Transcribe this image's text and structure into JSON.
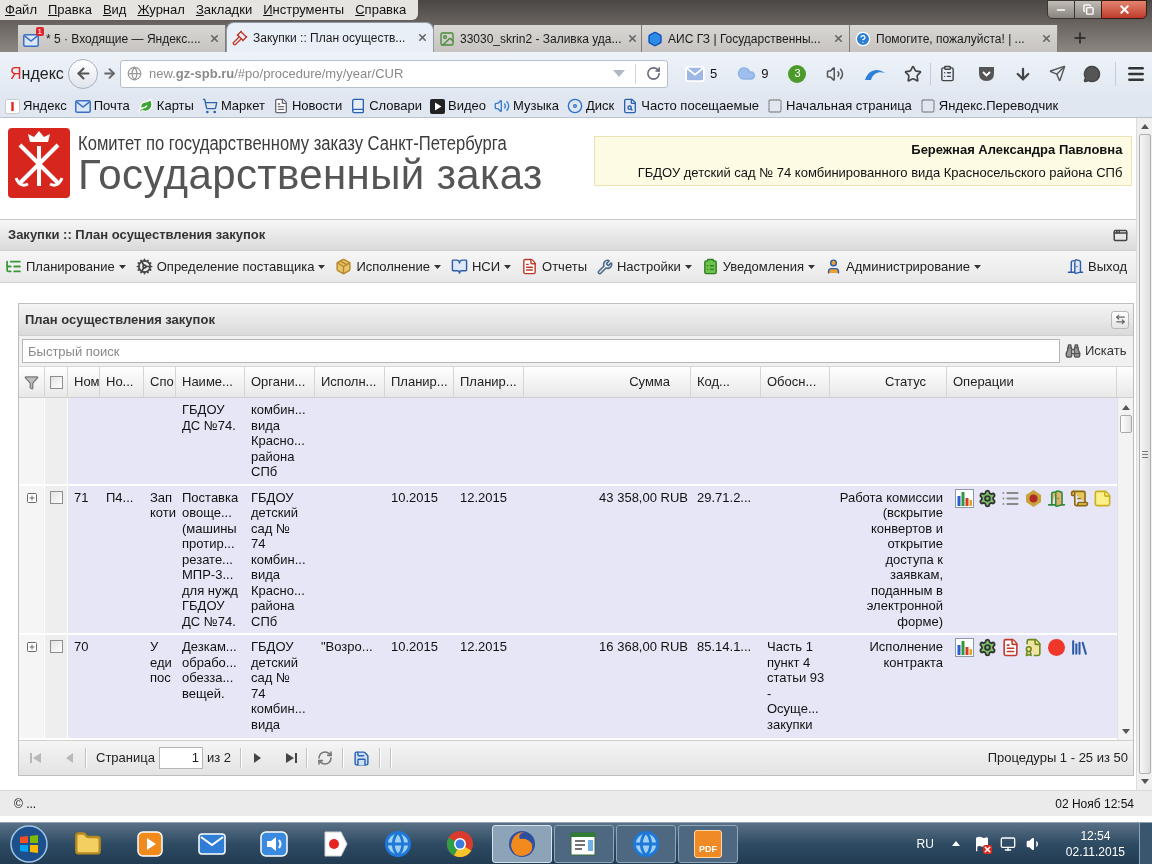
{
  "browser": {
    "menu": [
      "Файл",
      "Правка",
      "Вид",
      "Журнал",
      "Закладки",
      "Инструменты",
      "Справка"
    ],
    "tabs": [
      {
        "title": "* 5 · Входящие — Яндекс....",
        "badge": "1",
        "selected": false
      },
      {
        "title": "Закупки :: План осуществ...",
        "selected": true
      },
      {
        "title": "33030_skrin2 - Заливка уда...",
        "selected": false
      },
      {
        "title": "АИС ГЗ | Государственны...",
        "selected": false
      },
      {
        "title": "Помогите, пожалуйста! | ...",
        "selected": false
      }
    ],
    "brand": "Яндекс",
    "url": "new.**gz-spb.ru**/#po/procedure/my/year/CUR",
    "addons": [
      {
        "kind": "mail",
        "count": "5"
      },
      {
        "kind": "weather",
        "count": "9"
      },
      {
        "kind": "notifications",
        "count": "3"
      }
    ],
    "bookmarks": [
      "Яндекс",
      "Почта",
      "Карты",
      "Маркет",
      "Новости",
      "Словари",
      "Видео",
      "Музыка",
      "Диск",
      "Часто посещаемые",
      "Начальная страница",
      "Яндекс.Переводчик"
    ]
  },
  "header": {
    "org": "Комитет по государственному заказу Санкт-Петербурга",
    "title": "Государственный заказ",
    "user": {
      "name": "Бережная Александра Павловна",
      "org": "ГБДОУ детский сад № 74 комбинированного вида Красносельского района СПб"
    }
  },
  "app": {
    "title": "Закупки :: План осуществления закупок",
    "menu": [
      {
        "label": "Планирование",
        "dropdown": true
      },
      {
        "label": "Определение поставщика",
        "dropdown": true
      },
      {
        "label": "Исполнение",
        "dropdown": true
      },
      {
        "label": "НСИ",
        "dropdown": true
      },
      {
        "label": "Отчеты",
        "dropdown": false
      },
      {
        "label": "Настройки",
        "dropdown": true
      },
      {
        "label": "Уведомления",
        "dropdown": true
      },
      {
        "label": "Администрирование",
        "dropdown": true
      }
    ],
    "exit": "Выход"
  },
  "grid": {
    "title": "План осуществления закупок",
    "search": {
      "placeholder": "Быстрый поиск",
      "button": "Искать"
    },
    "select_all": {
      "checked": false
    },
    "columns": [
      "Ном",
      "Но...",
      "Спо",
      "Наиме...",
      "Органи...",
      "Исполн...",
      "Планир...",
      "Планир...",
      "Сумма",
      "Код...",
      "Обосн...",
      "Статус",
      "Операции"
    ],
    "rows": [
      {
        "cells": [
          null,
          null,
          null,
          "ГБДОУ\nДС №74.",
          "комбин...\nвида\nКрасно...\nрайона\nСПб",
          null,
          null,
          null,
          null,
          null,
          null,
          null
        ]
      },
      {
        "expanded": false,
        "checked": false,
        "cells": [
          "71",
          "П4...",
          "Зап\nкоти",
          "Поставка\nовоще...\n(машины\nпротир...\nрезате...\nМПР-3...\nдля нужд\nГБДОУ\nДС №74.",
          "ГБДОУ\nдетский\nсад №\n74\nкомбин...\nвида\nКрасно...\nрайона\nСПб",
          null,
          "10.2015",
          "12.2015",
          "43 358,00 RUB",
          "29.71.2...",
          null,
          "Работа комиссии\n(вскрытие\nконвертов и\nоткрытие\nдоступа к\nзаявкам,\nподанным в\nэлектронной\nформе)"
        ],
        "operations": [
          {
            "kind": "report"
          },
          {
            "kind": "settings"
          },
          {
            "kind": "list"
          },
          {
            "kind": "emblem"
          },
          {
            "kind": "exit"
          },
          {
            "kind": "archive"
          },
          {
            "kind": "note"
          }
        ]
      },
      {
        "expanded": false,
        "checked": false,
        "cells": [
          "70",
          null,
          "У\nеди\nпос",
          "Дезкам...\nобрабо...\nобезза...\nвещей.",
          "ГБДОУ\nдетский\nсад №\n74\nкомбин...\nвида",
          "\"Возро...",
          "10.2015",
          "12.2015",
          "16 368,00 RUB",
          "85.14.1...",
          "Часть 1\nпункт 4\nстатьи 93\n-\nОсуще...\nзакупки",
          "Исполнение\nконтракта"
        ],
        "operations": [
          {
            "kind": "report"
          },
          {
            "kind": "settings"
          },
          {
            "kind": "document"
          },
          {
            "kind": "certificate"
          },
          {
            "kind": "stop"
          },
          {
            "kind": "books"
          }
        ]
      }
    ],
    "pager": {
      "page_label": "Страница",
      "page": "1",
      "page_count": "из 2",
      "summary": "Процедуры 1 - 25 из 50",
      "back_disabled": true,
      "forward_disabled": false
    }
  },
  "footer": {
    "copyright": "© ...",
    "datetime": "02 Нояб 12:54"
  },
  "taskbar": {
    "apps": [
      {
        "running": false,
        "selected": false
      },
      {
        "running": false,
        "selected": false
      },
      {
        "running": false,
        "selected": false
      },
      {
        "running": false,
        "selected": false
      },
      {
        "running": false,
        "selected": false
      },
      {
        "running": false,
        "selected": false
      },
      {
        "running": false,
        "selected": false
      },
      {
        "running": true,
        "selected": true
      },
      {
        "running": true,
        "selected": false
      },
      {
        "running": true,
        "selected": false
      },
      {
        "running": true,
        "selected": false,
        "label": "PDF"
      }
    ],
    "language": "RU",
    "time": "12:54",
    "date": "02.11.2015"
  }
}
